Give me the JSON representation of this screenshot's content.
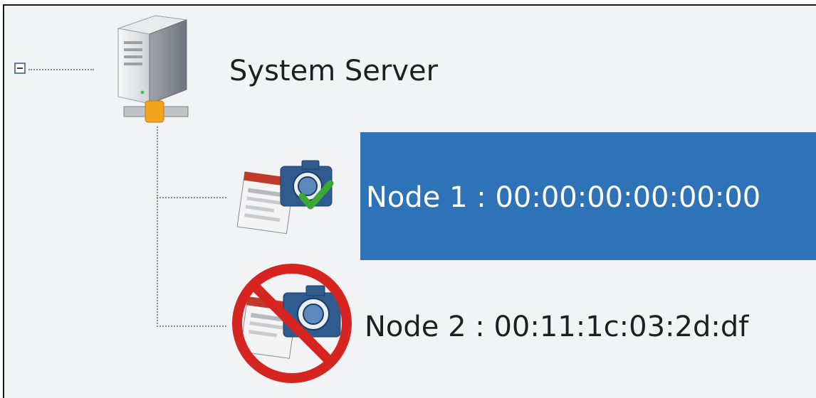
{
  "tree": {
    "root": {
      "label": "System Server",
      "icon": "server-icon",
      "expanded": true
    },
    "nodes": [
      {
        "label": "Node 1 : 00:00:00:00:00:00",
        "icon": "camera-node-online-icon",
        "status": "online",
        "selected": true
      },
      {
        "label": "Node 2 : 00:11:1c:03:2d:df",
        "icon": "camera-node-disabled-icon",
        "status": "disabled",
        "selected": false
      }
    ]
  },
  "colors": {
    "background": "#f2f3f5",
    "selection": "#2e73b8",
    "check": "#3aa832",
    "prohibit": "#d62420"
  }
}
